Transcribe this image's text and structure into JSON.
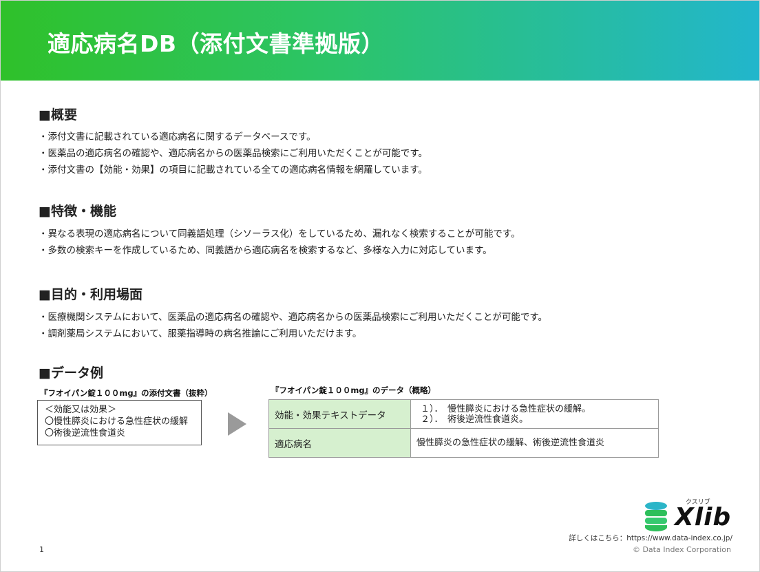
{
  "banner": {
    "title": "適応病名DB（添付文書準拠版）"
  },
  "sections": [
    {
      "heading": "■概要",
      "lines": [
        "・添付文書に記載されている適応病名に関するデータベースです。",
        "・医薬品の適応病名の確認や、適応病名からの医薬品検索にご利用いただくことが可能です。",
        "・添付文書の【効能・効果】の項目に記載されている全ての適応病名情報を網羅しています。"
      ]
    },
    {
      "heading": "■特徴・機能",
      "lines": [
        "・異なる表現の適応病名について同義語処理（シソーラス化）をしているため、漏れなく検索することが可能です。",
        "・多数の検索キーを作成しているため、同義語から適応病名を検索するなど、多様な入力に対応しています。"
      ]
    },
    {
      "heading": "■目的・利用場面",
      "lines": [
        "・医療機関システムにおいて、医薬品の適応病名の確認や、適応病名からの医薬品検索にご利用いただくことが可能です。",
        "・調剤薬局システムにおいて、服薬指導時の病名推論にご利用いただけます。"
      ]
    },
    {
      "heading": "■データ例",
      "lines": []
    }
  ],
  "example": {
    "source_caption": "『フオイパン錠１００mg』の添付文書（抜粋）",
    "source_lines": [
      "＜効能又は効果＞",
      "〇慢性膵炎における急性症状の緩解",
      "〇術後逆流性食道炎"
    ],
    "data_caption": "『フオイパン錠１００mg』のデータ（概略）",
    "table": [
      {
        "key": "効能・効果テキストデータ",
        "values": [
          "１）．　慢性膵炎における急性症状の緩解。",
          "２）．　術後逆流性食道炎。"
        ]
      },
      {
        "key": "適応病名",
        "values": [
          "慢性膵炎の急性症状の緩解、術後逆流性食道炎"
        ]
      }
    ]
  },
  "footer": {
    "logo_text": "Xlib",
    "logo_ruby": "クスリブ",
    "link_text": "詳しくはこちら：https://www.data-index.co.jp/",
    "copyright": "© Data Index Corporation",
    "page_number": "1"
  },
  "colors": {
    "banner_start": "#2fc12a",
    "banner_end": "#22b6cc",
    "table_key_bg": "#d6f0cf",
    "logo_green": "#2dbf5a",
    "logo_cyan": "#2bb5c8"
  }
}
